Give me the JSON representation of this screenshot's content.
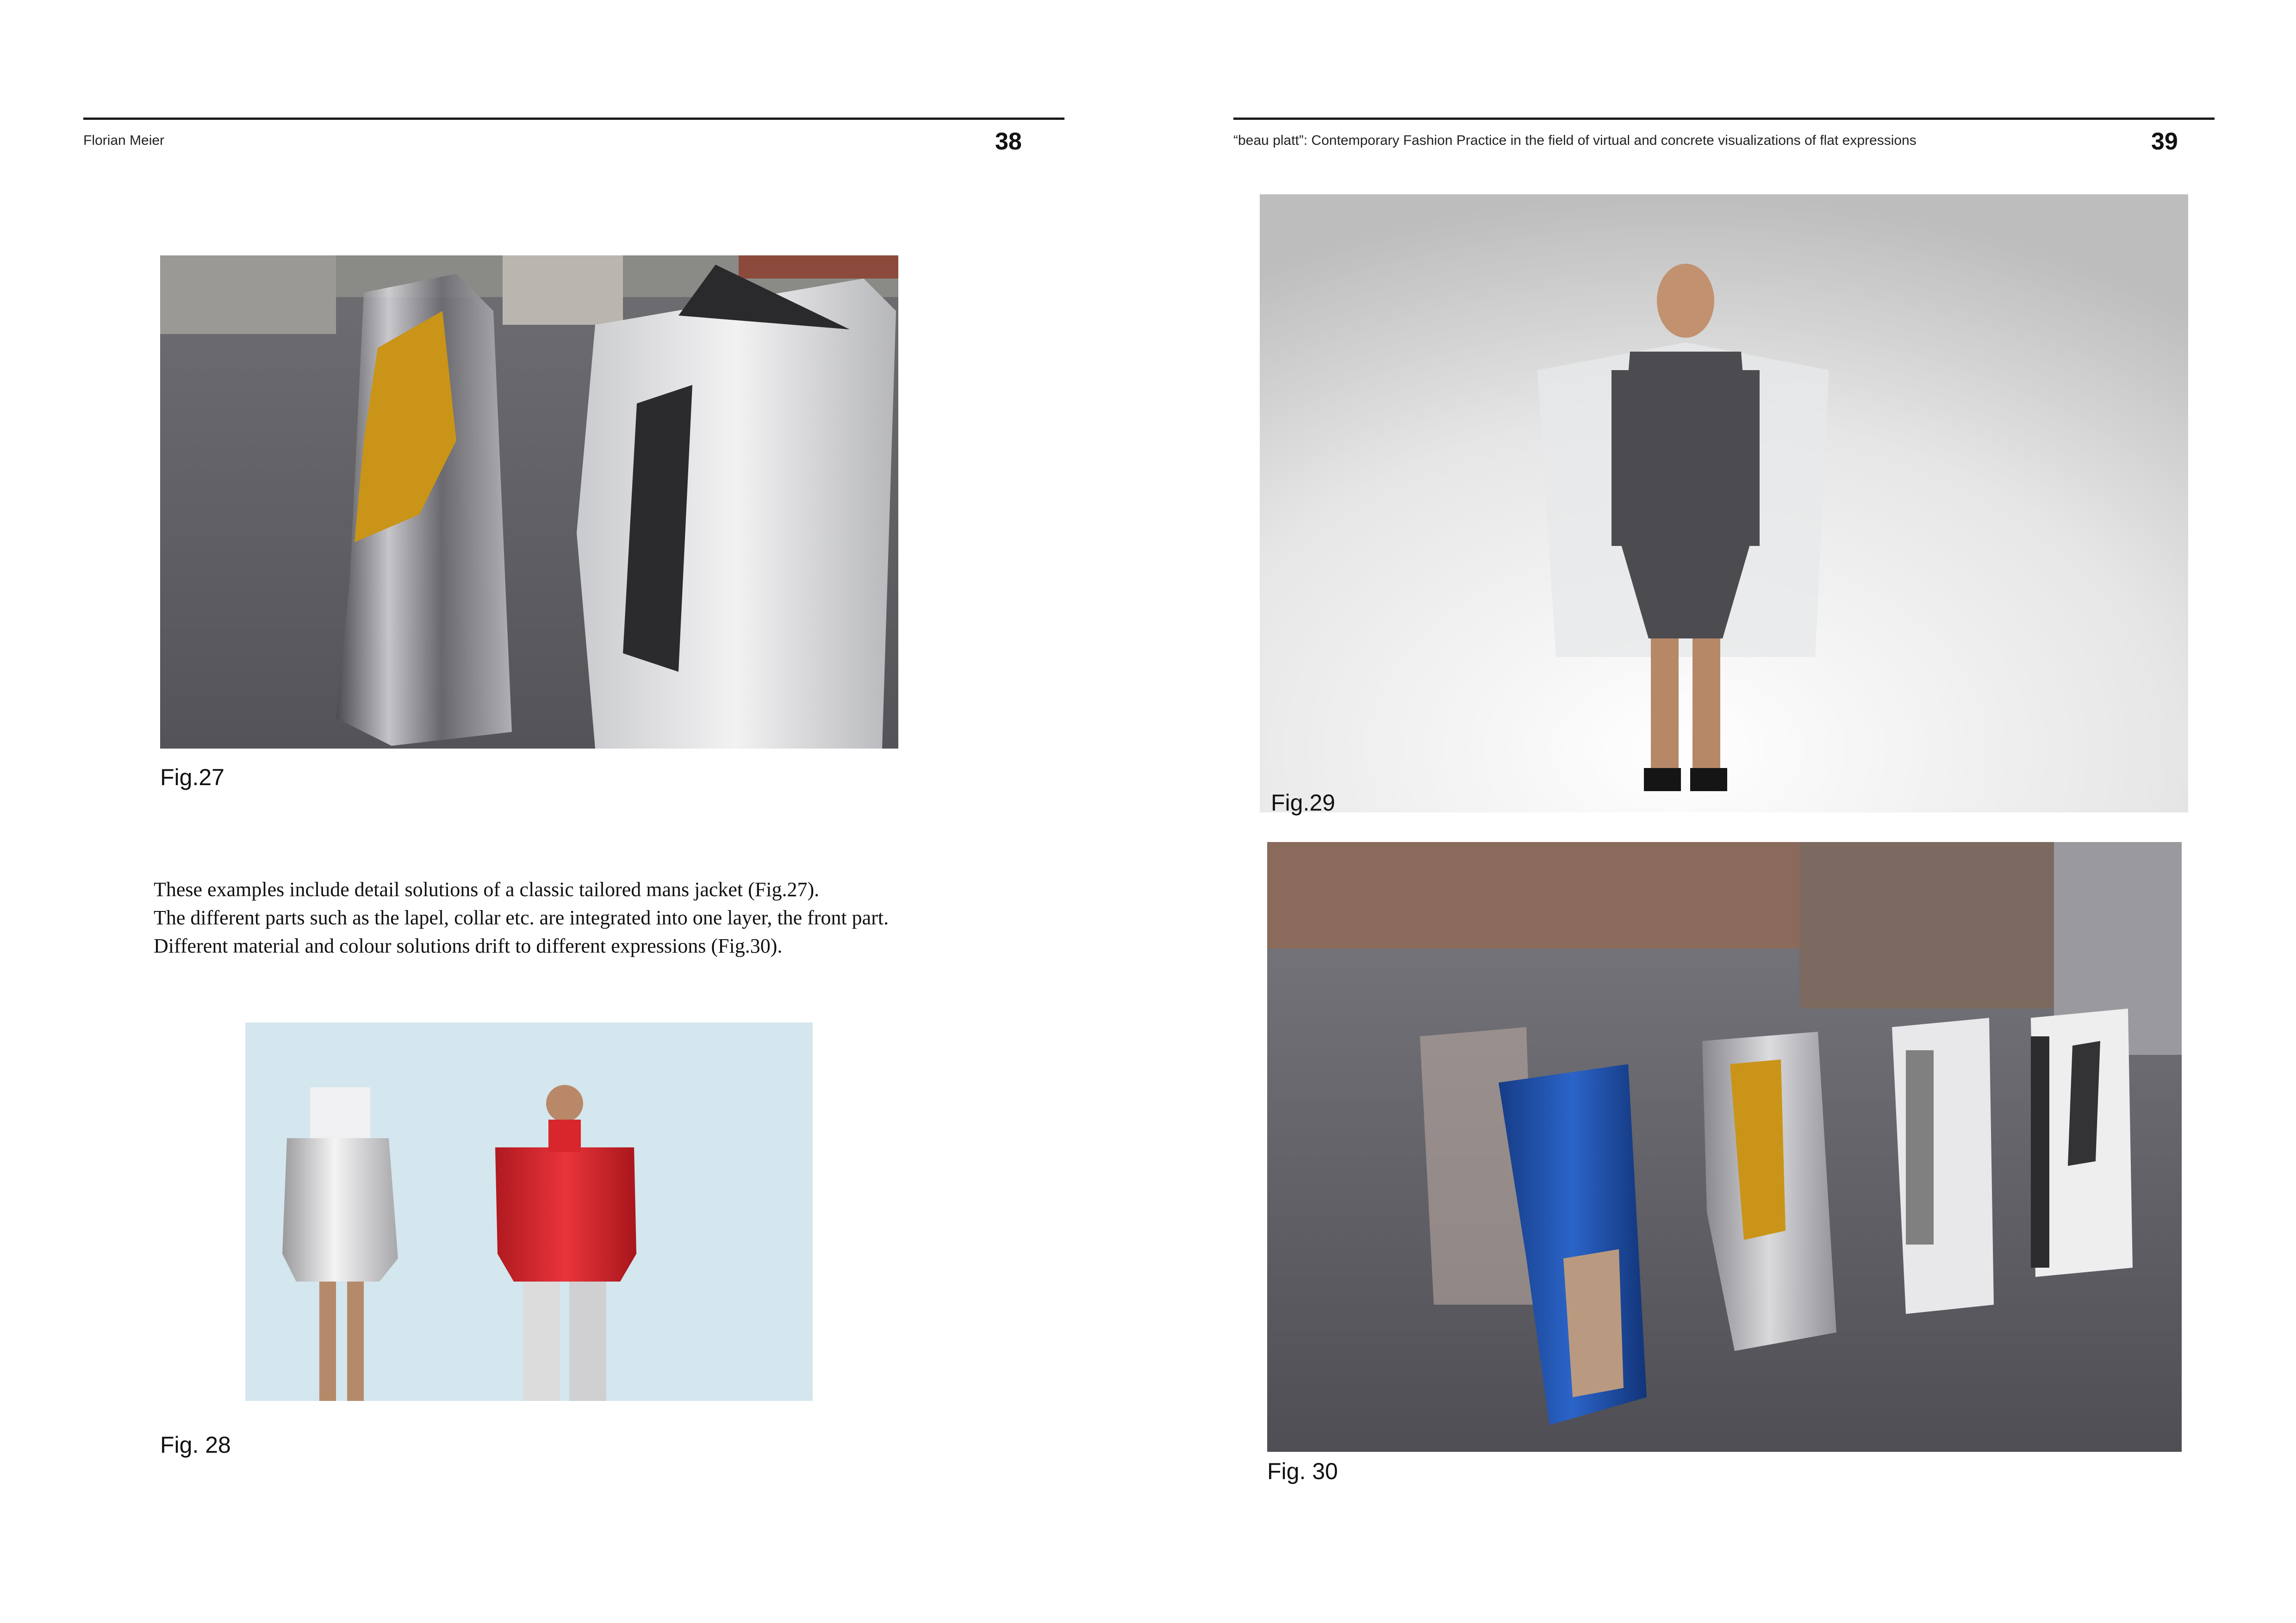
{
  "left_page": {
    "running_head": "Florian Meier",
    "page_number": "38",
    "figures": [
      {
        "caption": "Fig.27"
      },
      {
        "caption": "Fig. 28"
      }
    ],
    "body_lines": [
      "These examples include detail solutions of a classic tailored mans jacket (Fig.27).",
      "The different parts such as the lapel, collar etc. are integrated into one layer, the front part.",
      "Different material and colour solutions drift to different expressions (Fig.30)."
    ]
  },
  "right_page": {
    "running_head": "“beau platt”: Contemporary Fashion Practice in the field of virtual and concrete visualizations of flat expressions",
    "page_number": "39",
    "figures": [
      {
        "caption": "Fig.29"
      },
      {
        "caption": "Fig. 30"
      }
    ]
  },
  "colors": {
    "rule": "#1a1a1a",
    "text": "#111111",
    "fig28_background": "#d4e6ee",
    "red_garment": "#d8262c",
    "blue_garment": "#1e4fa8",
    "gold_garment": "#c99418"
  }
}
